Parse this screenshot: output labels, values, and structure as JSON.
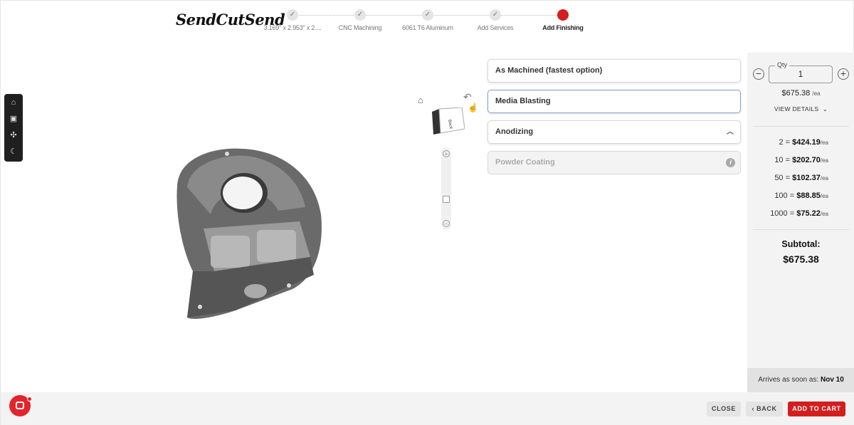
{
  "header": {
    "logo_text": "SendCutSend",
    "steps": [
      {
        "label": "3.169\" x 2.953\" x 2....",
        "status": "done"
      },
      {
        "label": "CNC Machining",
        "status": "done"
      },
      {
        "label": "6061 T6 Aluminum",
        "status": "done"
      },
      {
        "label": "Add Services",
        "status": "done"
      },
      {
        "label": "Add Finishing",
        "status": "active"
      }
    ]
  },
  "viewer": {
    "cube_face": "Back",
    "left_tools": [
      "home-icon",
      "frame-icon",
      "explode-icon",
      "moon-icon"
    ]
  },
  "finishing": {
    "options": [
      {
        "label": "As Machined (fastest option)",
        "state": "default"
      },
      {
        "label": "Media Blasting",
        "state": "selected"
      },
      {
        "label": "Anodizing",
        "state": "expandable"
      },
      {
        "label": "Powder Coating",
        "state": "disabled"
      }
    ]
  },
  "pricing": {
    "qty_label": "Qty",
    "qty_value": "1",
    "unit_price": "$675.38",
    "unit_suffix": "/ea",
    "view_details": "VIEW DETAILS",
    "tiers": [
      {
        "qty": "2",
        "eq": " = ",
        "price": "$424.19",
        "suffix": "/ea"
      },
      {
        "qty": "10",
        "eq": " = ",
        "price": "$202.70",
        "suffix": "/ea"
      },
      {
        "qty": "50",
        "eq": " = ",
        "price": "$102.37",
        "suffix": "/ea"
      },
      {
        "qty": "100",
        "eq": " = ",
        "price": "$88.85",
        "suffix": "/ea"
      },
      {
        "qty": "1000",
        "eq": " = ",
        "price": "$75.22",
        "suffix": "/ea"
      }
    ],
    "subtotal_label": "Subtotal:",
    "subtotal_value": "$675.38",
    "arrives_label": "Arrives as soon as: ",
    "arrives_date": "Nov 10"
  },
  "footer": {
    "close_label": "CLOSE",
    "back_label": "BACK",
    "add_to_cart_label": "ADD TO CART"
  },
  "colors": {
    "accent": "#d41e1e",
    "selected_border": "#7fa3c9"
  }
}
